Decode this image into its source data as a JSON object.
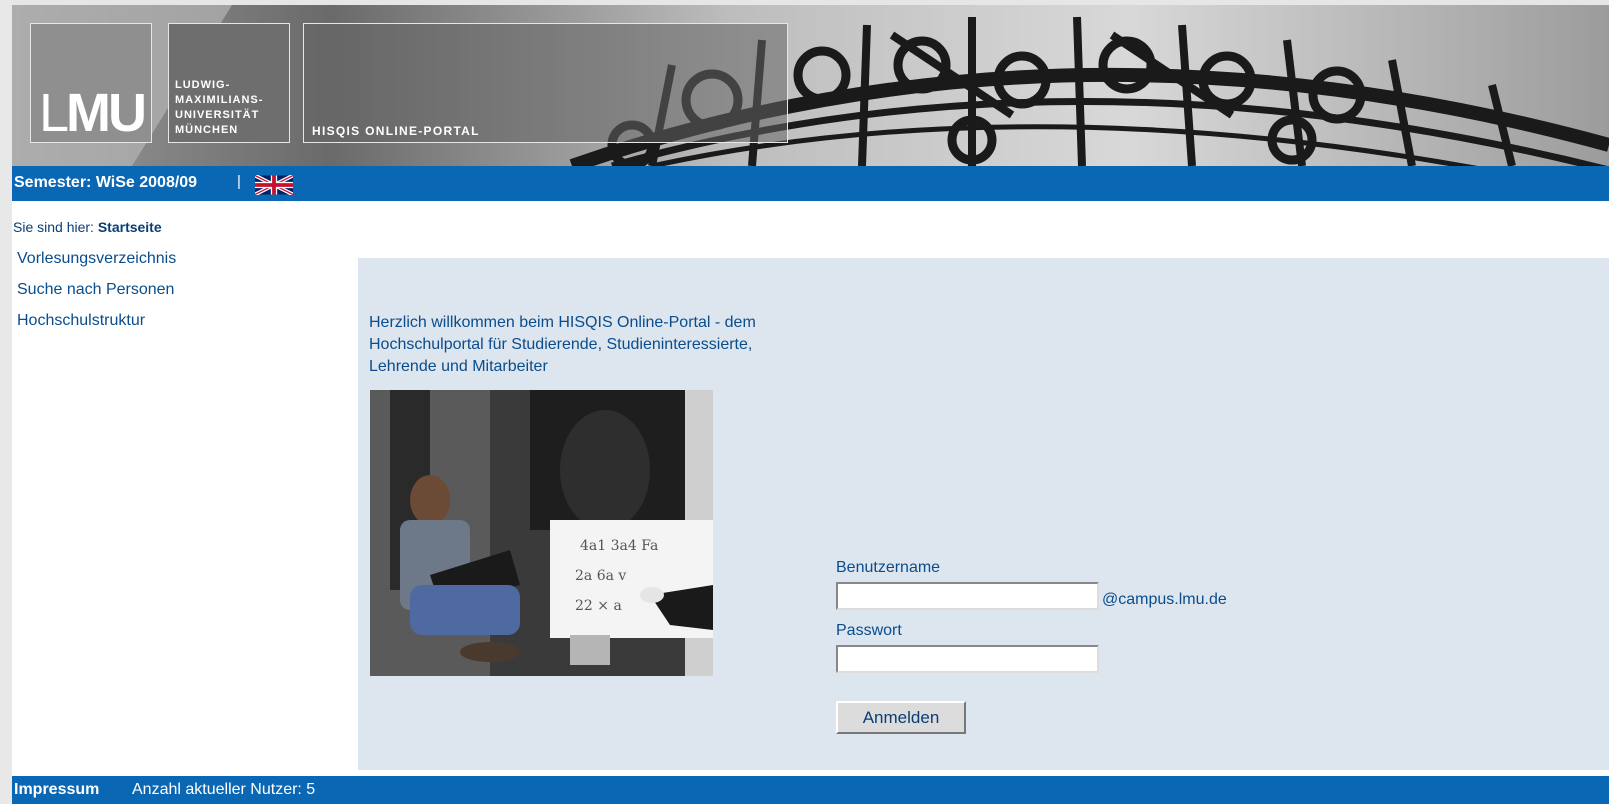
{
  "header": {
    "logo_text_bold": "MU",
    "logo_text_l": "L",
    "university_name": [
      "LUDWIG-",
      "MAXIMILIANS-",
      "UNIVERSITÄT",
      "MÜNCHEN"
    ],
    "portal_title": "HISQIS ONLINE-PORTAL"
  },
  "semester_bar": {
    "label": "Semester: WiSe 2008/09",
    "separator": "|",
    "language_icon": "uk-flag-icon"
  },
  "breadcrumb": {
    "prefix": "Sie sind hier:",
    "current": "Startseite"
  },
  "nav": {
    "items": [
      {
        "label": "Vorlesungsverzeichnis"
      },
      {
        "label": "Suche nach Personen"
      },
      {
        "label": "Hochschulstruktur"
      }
    ]
  },
  "main": {
    "welcome": "Herzlich willkommen beim HISQIS Online-Portal - dem Hochschulportal für Studierende, Studieninteressierte, Lehrende und Mitarbeiter"
  },
  "login": {
    "username_label": "Benutzername",
    "username_value": "",
    "domain_suffix": "@campus.lmu.de",
    "password_label": "Passwort",
    "password_value": "",
    "submit_label": "Anmelden"
  },
  "footer": {
    "impressum": "Impressum",
    "users": "Anzahl aktueller Nutzer: 5"
  },
  "colors": {
    "bar_blue": "#0a67b3",
    "panel": "#dde5ee",
    "link": "#0a4d8c"
  }
}
